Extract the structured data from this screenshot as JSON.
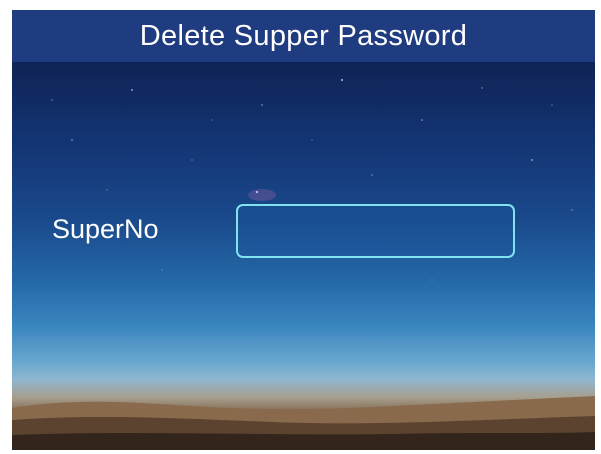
{
  "screen": {
    "title": "Delete Supper Password"
  },
  "form": {
    "super_no_label": "SuperNo",
    "super_no_value": ""
  },
  "colors": {
    "title_bar": "#1f3c80",
    "input_border": "#7fe4f0",
    "text": "#ffffff"
  }
}
